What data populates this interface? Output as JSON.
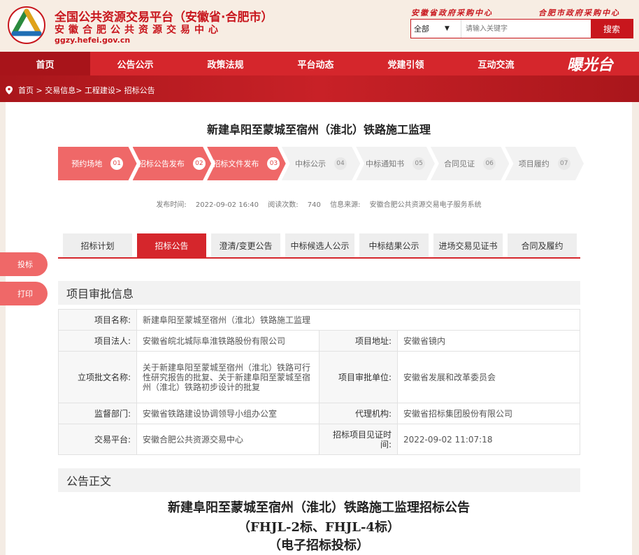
{
  "header": {
    "title": "全国公共资源交易平台（安徽省·合肥市）",
    "subtitle": "安徽合肥公共资源交易中心",
    "url": "ggzy.hefei.gov.cn",
    "center1": "安徽省政府采购中心",
    "center2": "合肥市政府采购中心",
    "search": {
      "scope": "全部",
      "placeholder": "请输入关键字",
      "button": "搜索"
    }
  },
  "nav": {
    "items": [
      "首页",
      "公告公示",
      "政策法规",
      "平台动态",
      "党建引领",
      "互动交流"
    ],
    "logo_text": "曝光台"
  },
  "breadcrumb": [
    "首页",
    "交易信息",
    "工程建设",
    "招标公告"
  ],
  "page": {
    "title": "新建阜阳至蒙城至宿州（淮北）铁路施工监理",
    "steps": [
      {
        "label": "预约场地",
        "num": "01"
      },
      {
        "label": "招标公告发布",
        "num": "02"
      },
      {
        "label": "招标文件发布",
        "num": "03"
      },
      {
        "label": "中标公示",
        "num": "04"
      },
      {
        "label": "中标通知书",
        "num": "05"
      },
      {
        "label": "合同见证",
        "num": "06"
      },
      {
        "label": "项目履约",
        "num": "07"
      }
    ],
    "meta": {
      "publish_label": "发布时间:",
      "publish_time": "2022-09-02 16:40",
      "views_label": "阅读次数:",
      "views": "740",
      "source_label": "信息来源:",
      "source": "安徽合肥公共资源交易电子服务系统"
    },
    "tabs": [
      "招标计划",
      "招标公告",
      "澄清/变更公告",
      "中标候选人公示",
      "中标结果公示",
      "进场交易见证书",
      "合同及履约"
    ],
    "section1": "项目审批信息",
    "info": {
      "name_label": "项目名称:",
      "name": "新建阜阳至蒙城至宿州（淮北）铁路施工监理",
      "legal_label": "项目法人:",
      "legal": "安徽省皖北城际阜淮铁路股份有限公司",
      "addr_label": "项目地址:",
      "addr": "安徽省镜内",
      "approval_label": "立项批文名称:",
      "approval": "关于新建阜阳至蒙城至宿州（淮北）铁路可行性研究报告的批复、关于新建阜阳至蒙城至宿州（淮北）铁路初步设计的批复",
      "approver_label": "项目审批单位:",
      "approver": "安徽省发展和改革委员会",
      "supervise_label": "监督部门:",
      "supervise": "安徽省铁路建设协调领导小组办公室",
      "agent_label": "代理机构:",
      "agent": "安徽省招标集团股份有限公司",
      "platform_label": "交易平台:",
      "platform": "安徽合肥公共资源交易中心",
      "witness_label": "招标项目见证时间:",
      "witness": "2022-09-02 11:07:18"
    },
    "section2": "公告正文",
    "doc_title1": "新建阜阳至蒙城至宿州（淮北）铁路施工监理招标公告",
    "doc_title2": "（FHJL-2标、FHJL-4标）",
    "doc_title3": "（电子招标投标）"
  },
  "side": {
    "bid": "投标",
    "print": "打印"
  }
}
